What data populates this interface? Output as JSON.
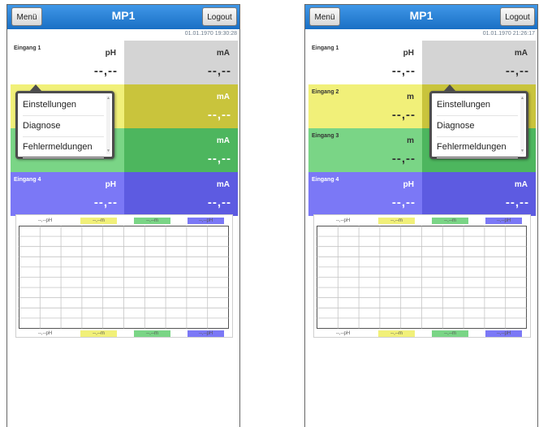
{
  "colors": {
    "header": "#2a82d6",
    "gray": "#d4d4d4",
    "yellow_light": "#f1f079",
    "yellow_dark": "#c9c43c",
    "green_light": "#7ad586",
    "green_dark": "#4db65e",
    "blue_light": "#7b78f6",
    "blue_dark": "#5d5be1"
  },
  "screens": [
    {
      "menu_label": "Menü",
      "title": "MP1",
      "logout_label": "Logout",
      "datetime": "01.01.1970 19:30:28",
      "cells": [
        {
          "name": "Eingang 1",
          "unit": "pH",
          "value": "--,--",
          "color": "#ffffff",
          "dark": false
        },
        {
          "name": "",
          "unit": "mA",
          "value": "--,--",
          "color": "#d4d4d4",
          "dark": false
        },
        {
          "name": "",
          "unit": "",
          "value": "",
          "color": "#f1f079",
          "dark": false
        },
        {
          "name": "",
          "unit": "mA",
          "value": "--,--",
          "color": "#c9c43c",
          "dark": true
        },
        {
          "name": "",
          "unit": "",
          "value": "",
          "color": "#7ad586",
          "dark": false
        },
        {
          "name": "",
          "unit": "mA",
          "value": "--,--",
          "color": "#4db65e",
          "dark": true
        },
        {
          "name": "Eingang 4",
          "unit": "pH",
          "value": "--,--",
          "color": "#7b78f6",
          "dark": true
        },
        {
          "name": "",
          "unit": "mA",
          "value": "--,--",
          "color": "#5d5be1",
          "dark": true
        }
      ],
      "chart_top_labels": [
        "--,--pH",
        "--,--m",
        "--,--m",
        "--,--pH"
      ],
      "chart_bottom_labels": [
        "--,--pH",
        "--,--m",
        "--,--m",
        "--,--pH"
      ],
      "popup": {
        "items": [
          "Einstellungen",
          "Diagnose",
          "Fehlermeldungen"
        ]
      }
    },
    {
      "menu_label": "Menü",
      "title": "MP1",
      "logout_label": "Logout",
      "datetime": "01.01.1970 21:26:17",
      "cells": [
        {
          "name": "Eingang 1",
          "unit": "pH",
          "value": "--,--",
          "color": "#ffffff",
          "dark": false
        },
        {
          "name": "",
          "unit": "mA",
          "value": "--,--",
          "color": "#d4d4d4",
          "dark": false
        },
        {
          "name": "Eingang 2",
          "unit": "m",
          "value": "--,--",
          "color": "#f1f079",
          "dark": false
        },
        {
          "name": "",
          "unit": "",
          "value": "",
          "color": "#c9c43c",
          "dark": true
        },
        {
          "name": "Eingang 3",
          "unit": "m",
          "value": "--,--",
          "color": "#7ad586",
          "dark": false
        },
        {
          "name": "",
          "unit": "",
          "value": "",
          "color": "#4db65e",
          "dark": true
        },
        {
          "name": "Eingang 4",
          "unit": "pH",
          "value": "--,--",
          "color": "#7b78f6",
          "dark": true
        },
        {
          "name": "",
          "unit": "mA",
          "value": "--,--",
          "color": "#5d5be1",
          "dark": true
        }
      ],
      "chart_top_labels": [
        "--,--pH",
        "--,--m",
        "--,--m",
        "--,--pH"
      ],
      "chart_bottom_labels": [
        "--,--pH",
        "--,--m",
        "--,--m",
        "--,--pH"
      ],
      "popup": {
        "items": [
          "Einstellungen",
          "Diagnose",
          "Fehlermeldungen"
        ]
      }
    }
  ]
}
